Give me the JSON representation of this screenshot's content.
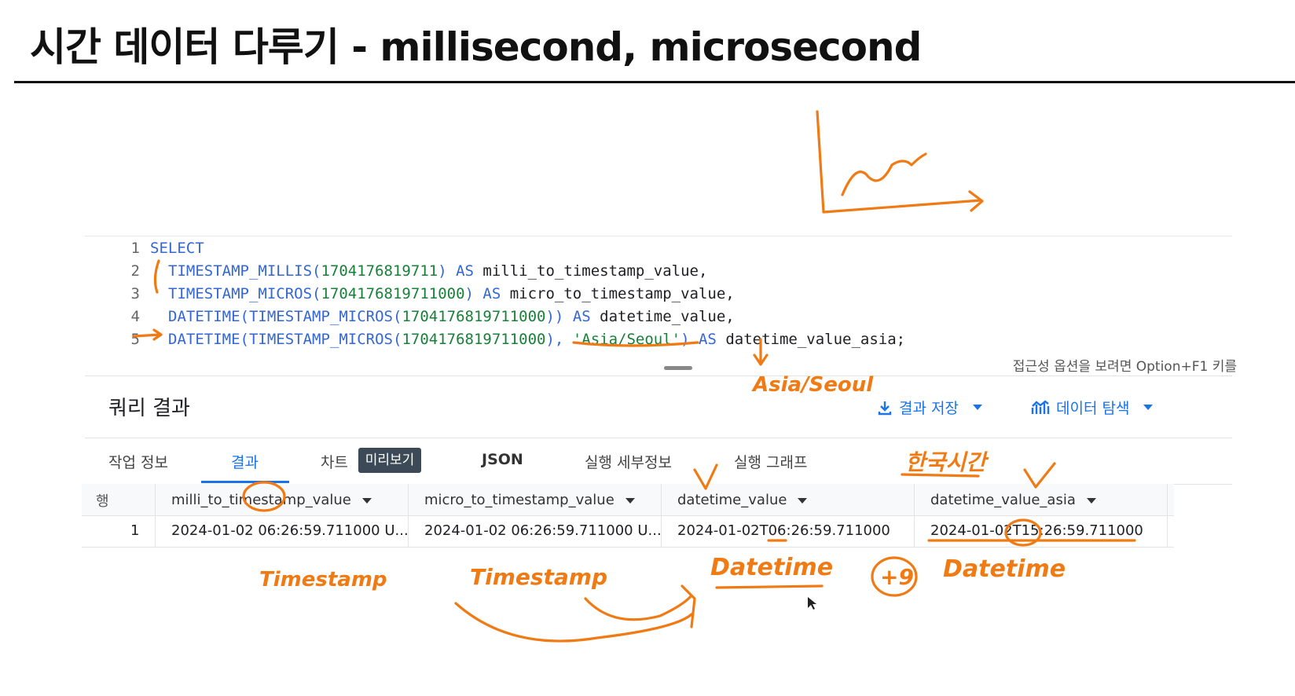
{
  "slide": {
    "title": "시간 데이터 다루기 - millisecond, microsecond"
  },
  "editor": {
    "lines": [
      {
        "n": "1",
        "parts": [
          {
            "t": "SELECT",
            "c": "kw"
          }
        ]
      },
      {
        "n": "2",
        "parts": [
          {
            "t": "TIMESTAMP_MILLIS",
            "c": "fn"
          },
          {
            "t": "(",
            "c": "punct"
          },
          {
            "t": "1704176819711",
            "c": "num"
          },
          {
            "t": ") ",
            "c": "punct"
          },
          {
            "t": "AS",
            "c": "kw"
          },
          {
            "t": " milli_to_timestamp_value,",
            "c": "id"
          }
        ]
      },
      {
        "n": "3",
        "parts": [
          {
            "t": "TIMESTAMP_MICROS",
            "c": "fn"
          },
          {
            "t": "(",
            "c": "punct"
          },
          {
            "t": "1704176819711000",
            "c": "num"
          },
          {
            "t": ") ",
            "c": "punct"
          },
          {
            "t": "AS",
            "c": "kw"
          },
          {
            "t": " micro_to_timestamp_value,",
            "c": "id"
          }
        ]
      },
      {
        "n": "4",
        "parts": [
          {
            "t": "DATETIME",
            "c": "fn"
          },
          {
            "t": "(",
            "c": "punct"
          },
          {
            "t": "TIMESTAMP_MICROS",
            "c": "fn"
          },
          {
            "t": "(",
            "c": "punct"
          },
          {
            "t": "1704176819711000",
            "c": "num"
          },
          {
            "t": ")) ",
            "c": "punct"
          },
          {
            "t": "AS",
            "c": "kw"
          },
          {
            "t": " datetime_value,",
            "c": "id"
          }
        ]
      },
      {
        "n": "5",
        "parts": [
          {
            "t": "DATETIME",
            "c": "fn"
          },
          {
            "t": "(",
            "c": "punct"
          },
          {
            "t": "TIMESTAMP_MICROS",
            "c": "fn"
          },
          {
            "t": "(",
            "c": "punct"
          },
          {
            "t": "1704176819711000",
            "c": "num"
          },
          {
            "t": "), ",
            "c": "punct"
          },
          {
            "t": "'Asia/Seoul'",
            "c": "str"
          },
          {
            "t": ") ",
            "c": "punct"
          },
          {
            "t": "AS",
            "c": "kw"
          },
          {
            "t": " datetime_value_asia;",
            "c": "id"
          }
        ]
      }
    ],
    "accessibility_hint": "접근성 옵션을 보려면 Option+F1 키를"
  },
  "results": {
    "title": "쿼리 결과",
    "save_label": "결과 저장",
    "explore_label": "데이터 탐색"
  },
  "tabs": {
    "job_info": "작업 정보",
    "results": "결과",
    "chart": "차트",
    "preview_badge": "미리보기",
    "json": "JSON",
    "execution_details": "실행 세부정보",
    "execution_graph": "실행 그래프"
  },
  "grid": {
    "row_header": "행",
    "columns": [
      "milli_to_timestamp_value",
      "micro_to_timestamp_value",
      "datetime_value",
      "datetime_value_asia"
    ],
    "rows": [
      {
        "n": "1",
        "cells": [
          "2024-01-02 06:26:59.711000 U...",
          "2024-01-02 06:26:59.711000 U...",
          "2024-01-02T06:26:59.711000",
          "2024-01-02T15:26:59.711000"
        ]
      }
    ]
  },
  "annotations": {
    "asia_seoul": "Asia/Seoul",
    "korean_note": "한국시간",
    "timestamp_1": "Timestamp",
    "timestamp_2": "Timestamp",
    "datetime_1": "Datetime",
    "datetime_2": "Datetime",
    "plus_nine": "+9"
  },
  "colors": {
    "accent": "#1a73e8",
    "keyword": "#3367d6",
    "literal": "#188038",
    "ink": "#f07a14"
  }
}
